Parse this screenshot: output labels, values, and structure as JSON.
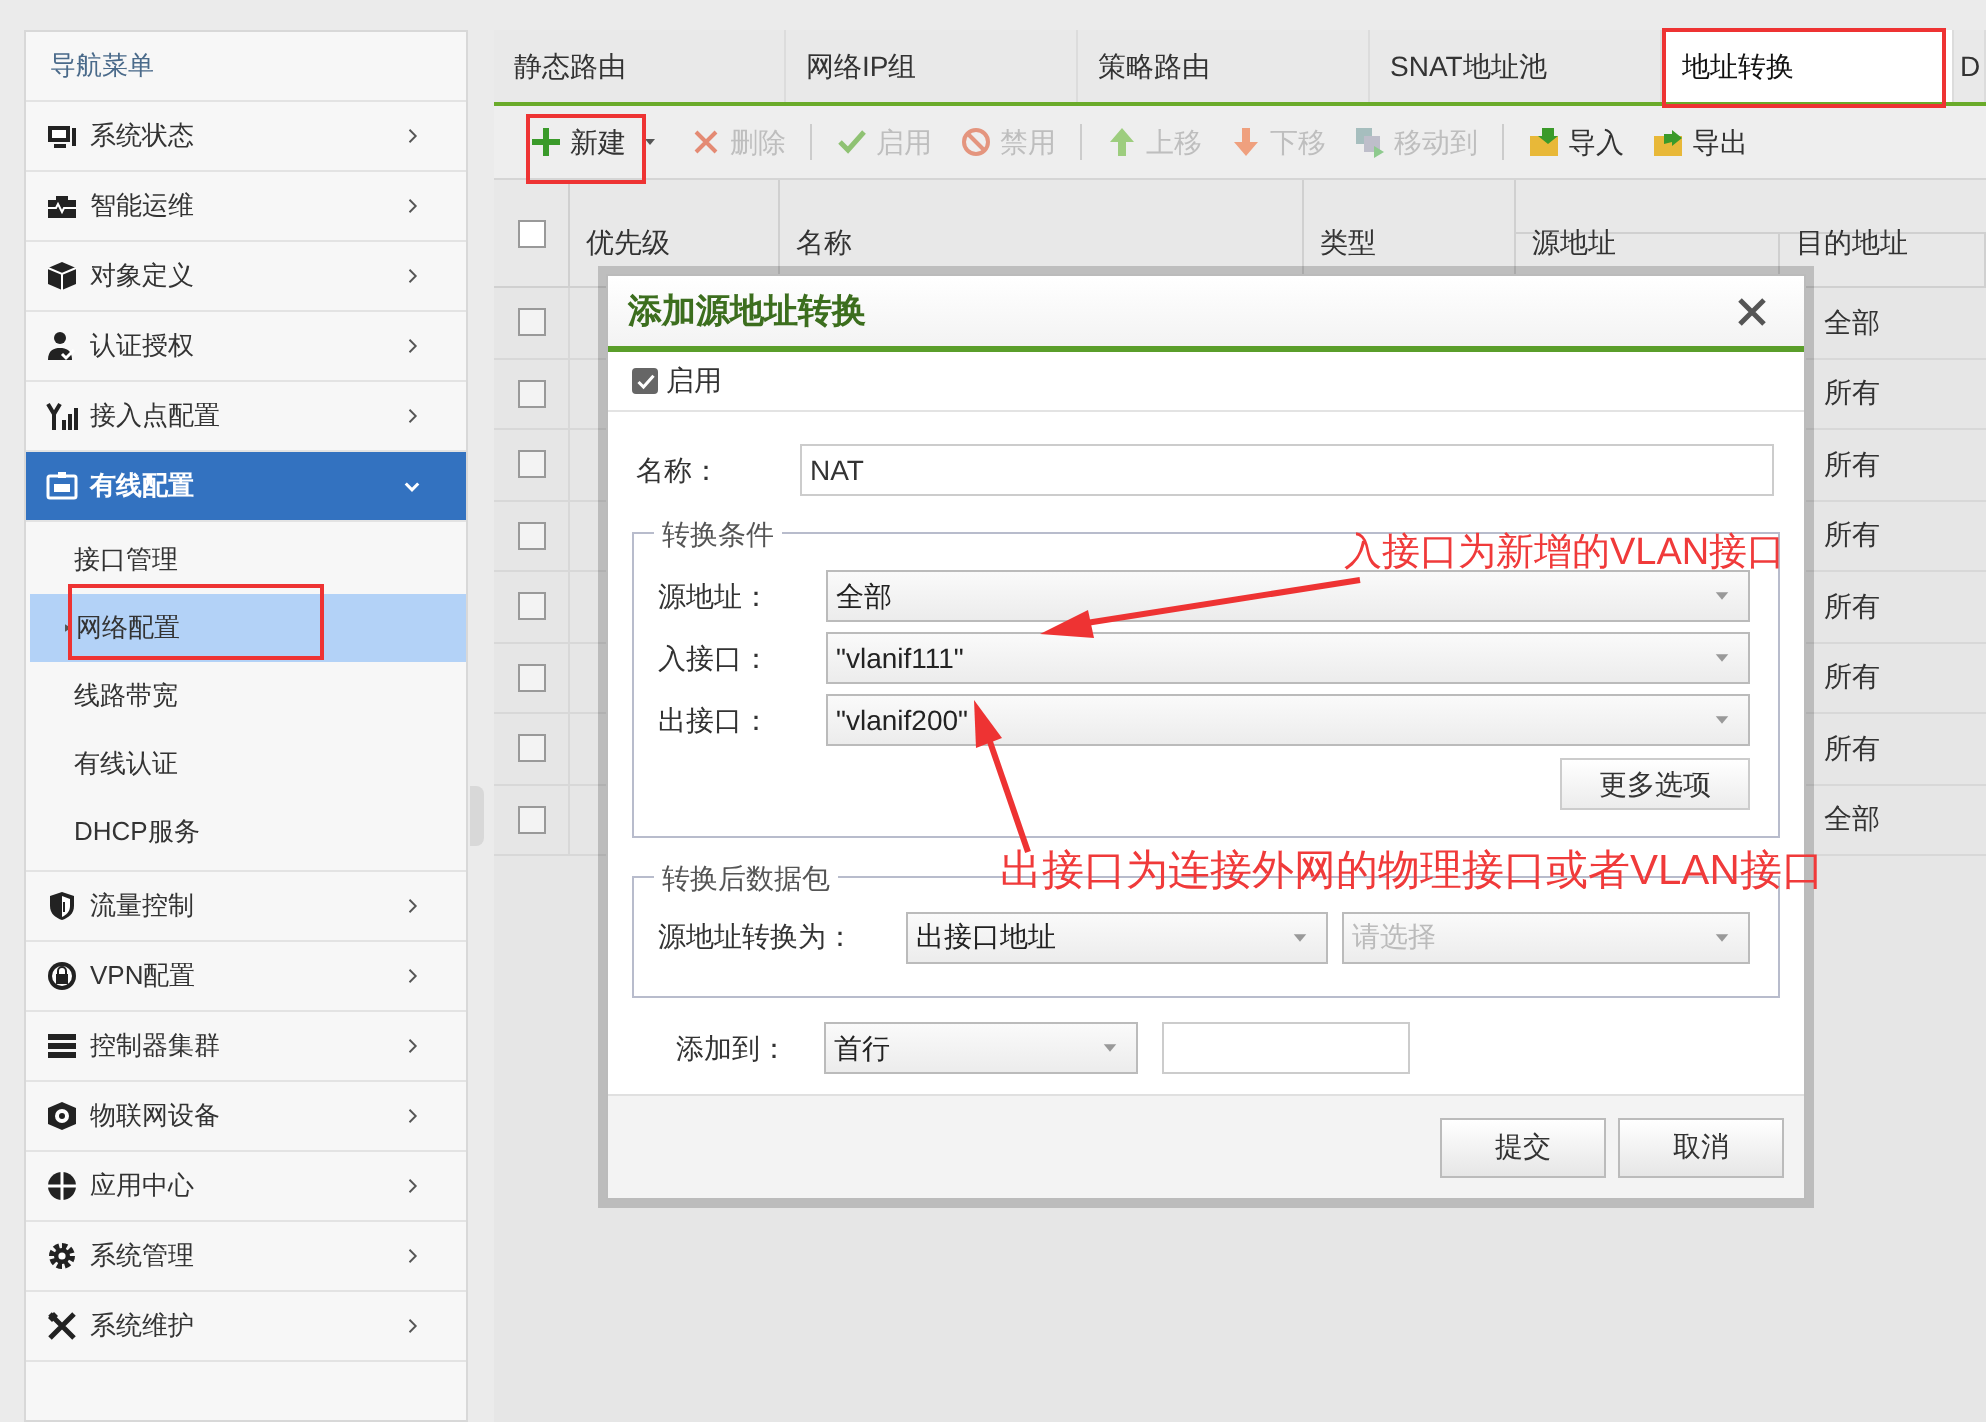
{
  "sidebar": {
    "title": "导航菜单",
    "items": [
      {
        "label": "系统状态",
        "selected": false,
        "expanded": false
      },
      {
        "label": "智能运维",
        "selected": false,
        "expanded": false
      },
      {
        "label": "对象定义",
        "selected": false,
        "expanded": false
      },
      {
        "label": "认证授权",
        "selected": false,
        "expanded": false
      },
      {
        "label": "接入点配置",
        "selected": false,
        "expanded": false
      },
      {
        "label": "有线配置",
        "selected": true,
        "expanded": true,
        "children": [
          {
            "label": "接口管理",
            "selected": false
          },
          {
            "label": "网络配置",
            "selected": true
          },
          {
            "label": "线路带宽",
            "selected": false
          },
          {
            "label": "有线认证",
            "selected": false
          },
          {
            "label": "DHCP服务",
            "selected": false
          }
        ]
      },
      {
        "label": "流量控制",
        "selected": false,
        "expanded": false
      },
      {
        "label": "VPN配置",
        "selected": false,
        "expanded": false
      },
      {
        "label": "控制器集群",
        "selected": false,
        "expanded": false
      },
      {
        "label": "物联网设备",
        "selected": false,
        "expanded": false
      },
      {
        "label": "应用中心",
        "selected": false,
        "expanded": false
      },
      {
        "label": "系统管理",
        "selected": false,
        "expanded": false
      },
      {
        "label": "系统维护",
        "selected": false,
        "expanded": false
      }
    ]
  },
  "tabs": [
    {
      "label": "静态路由",
      "selected": false
    },
    {
      "label": "网络IP组",
      "selected": false
    },
    {
      "label": "策略路由",
      "selected": false
    },
    {
      "label": "SNAT地址池",
      "selected": false
    },
    {
      "label": "地址转换",
      "selected": true
    },
    {
      "label": "D",
      "selected": false
    }
  ],
  "toolbar": [
    {
      "label": "新建",
      "disabled": false
    },
    {
      "label": "删除",
      "disabled": true
    },
    {
      "label": "启用",
      "disabled": true
    },
    {
      "label": "禁用",
      "disabled": true
    },
    {
      "label": "上移",
      "disabled": true
    },
    {
      "label": "下移",
      "disabled": true
    },
    {
      "label": "移动到",
      "disabled": true
    },
    {
      "label": "导入",
      "disabled": false
    },
    {
      "label": "导出",
      "disabled": false
    }
  ],
  "table": {
    "all_checked": false,
    "columns": [
      "优先级",
      "名称",
      "类型",
      "源地址",
      "目的地址"
    ],
    "rows": [
      {
        "checked": false,
        "destination": "全部"
      },
      {
        "checked": false,
        "destination": "所有"
      },
      {
        "checked": false,
        "destination": "所有"
      },
      {
        "checked": false,
        "destination": "所有"
      },
      {
        "checked": false,
        "destination": "所有"
      },
      {
        "checked": false,
        "destination": "所有"
      },
      {
        "checked": false,
        "destination": "所有"
      },
      {
        "checked": false,
        "destination": "全部"
      }
    ]
  },
  "dialog": {
    "title": "添加源地址转换",
    "enable": {
      "label": "启用",
      "checked": true
    },
    "name": {
      "label": "名称：",
      "value": "NAT"
    },
    "conditions": {
      "legend": "转换条件",
      "fields": [
        {
          "label": "源地址：",
          "value": "全部"
        },
        {
          "label": "入接口：",
          "value": "\"vlanif111\""
        },
        {
          "label": "出接口：",
          "value": "\"vlanif200\""
        }
      ],
      "more_button": "更多选项"
    },
    "after": {
      "legend": "转换后数据包",
      "label": "源地址转换为：",
      "value": "出接口地址",
      "placeholder": "请选择"
    },
    "add_to": {
      "label": "添加到：",
      "value": "首行"
    },
    "buttons": [
      "提交",
      "取消"
    ]
  },
  "annotations": [
    "入接口为新增的VLAN接口",
    "出接口为连接外网的物理接口或者VLAN接口"
  ]
}
